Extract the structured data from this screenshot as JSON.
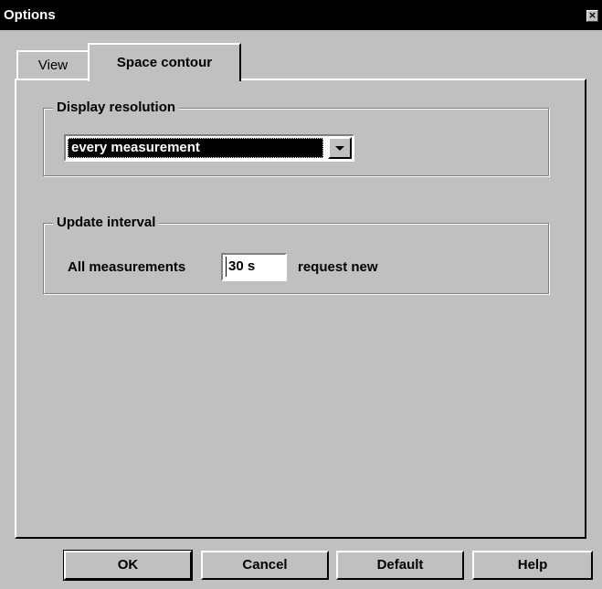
{
  "window": {
    "title": "Options",
    "close_glyph": "×"
  },
  "tabs": [
    {
      "label": "View",
      "active": false
    },
    {
      "label": "Space contour",
      "active": true
    }
  ],
  "display_resolution": {
    "legend": "Display resolution",
    "selected": "every measurement"
  },
  "update_interval": {
    "legend": "Update interval",
    "prefix_label": "All measurements",
    "value": "30 s",
    "suffix_label": "request new"
  },
  "buttons": {
    "ok": "OK",
    "cancel": "Cancel",
    "default": "Default",
    "help": "Help"
  },
  "colors": {
    "face": "#c0c0c0",
    "titlebar": "#000000",
    "selection": "#000000"
  }
}
